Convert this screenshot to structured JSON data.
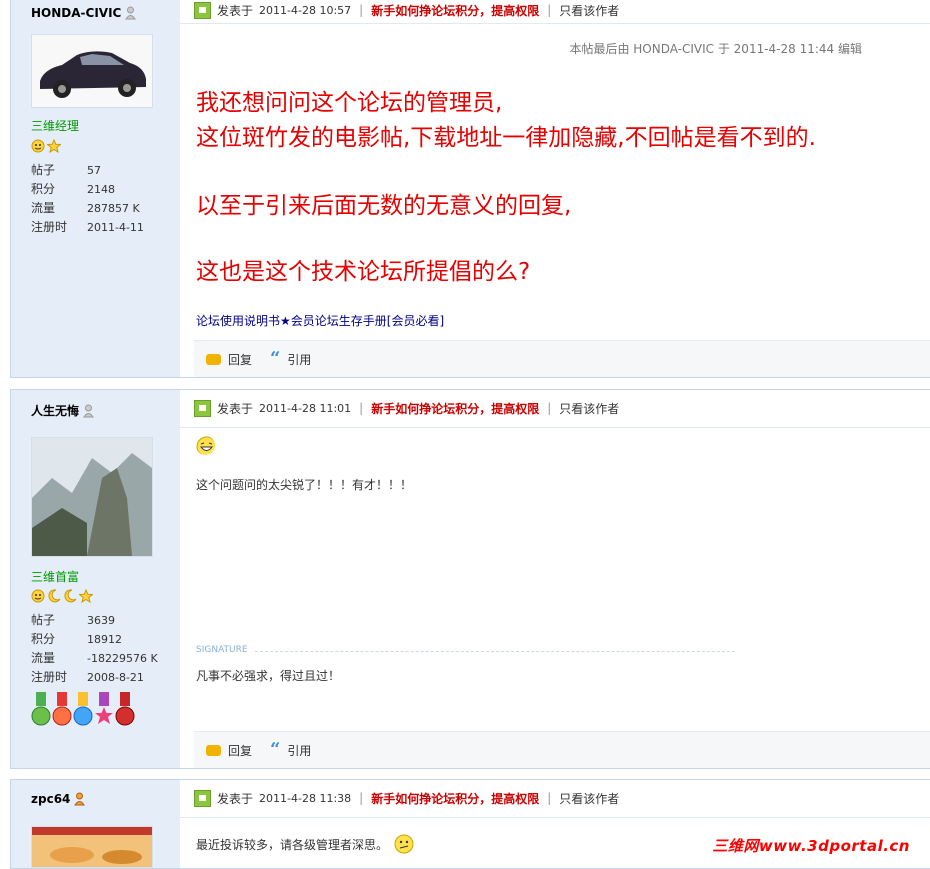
{
  "posts": [
    {
      "author": "HONDA-CIVIC",
      "group": "三维经理",
      "stats": [
        {
          "label": "帖子",
          "value": "57"
        },
        {
          "label": "积分",
          "value": "2148"
        },
        {
          "label": "流量",
          "value": "287857 K"
        },
        {
          "label": "注册时",
          "value": "2011-4-11"
        }
      ],
      "posted_label": "发表于",
      "time": "2011-4-28 10:57",
      "promo_link": "新手如何挣论坛积分，提高权限",
      "only_author": "只看该作者",
      "edited_note": "本帖最后由 HONDA-CIVIC 于 2011-4-28 11:44 编辑",
      "content_lines": [
        "我还想问问这个论坛的管理员,",
        "这位斑竹发的电影帖,下载地址一律加隐藏,不回帖是看不到的.",
        "以至于引来后面无数的无意义的回复,",
        "这也是这个技术论坛所提倡的么?"
      ],
      "footer_link": "论坛使用说明书★会员论坛生存手册[会员必看]",
      "reply": "回复",
      "quote": "引用"
    },
    {
      "author": "人生无悔",
      "group": "三维首富",
      "stats": [
        {
          "label": "帖子",
          "value": "3639"
        },
        {
          "label": "积分",
          "value": "18912"
        },
        {
          "label": "流量",
          "value": "-18229576 K"
        },
        {
          "label": "注册时",
          "value": "2008-8-21"
        }
      ],
      "posted_label": "发表于",
      "time": "2011-4-28 11:01",
      "promo_link": "新手如何挣论坛积分，提高权限",
      "only_author": "只看该作者",
      "content": "这个问题问的太尖锐了！！！有才！！！",
      "signature_label": "SIGNATURE",
      "signature": "凡事不必强求，得过且过！",
      "reply": "回复",
      "quote": "引用"
    },
    {
      "author": "zpc64",
      "posted_label": "发表于",
      "time": "2011-4-28 11:38",
      "promo_link": "新手如何挣论坛积分，提高权限",
      "only_author": "只看该作者",
      "content": "最近投诉较多，请各级管理者深思。"
    }
  ],
  "watermark": "三维网www.3dportal.cn",
  "colors": {
    "accent_red": "#cc0000",
    "group_green": "#009900",
    "sidebar_bg": "#e5eef8"
  }
}
